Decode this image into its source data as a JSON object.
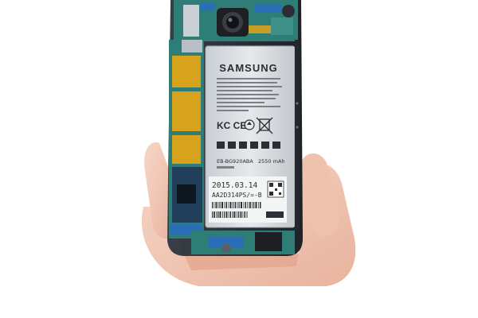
{
  "image": {
    "subject": "Smartphone with back cover removed held in a hand, showing battery and logic board",
    "colors": {
      "background": "#ffffff",
      "skin": "#f1c9b5",
      "skin_shadow": "#e3ab95",
      "board_green": "#2f7d77",
      "board_blue": "#2a6fb5",
      "shield_gold": "#d8a31c",
      "frame_dark": "#2c2f36",
      "battery_silver": "#d9dde1",
      "label_white": "#f4f5f5"
    }
  },
  "battery": {
    "brand": "SAMSUNG",
    "model": "EB-BG920ABA",
    "capacity": "2550 mAh",
    "date": "2015.03.14",
    "serial": "AA2D314PS/=-B"
  },
  "icons": {
    "ce_mark": "ce-mark-icon",
    "recycle": "recycle-icon",
    "crossed_bin": "crossed-bin-icon",
    "qr_code": "qr-code-icon",
    "camera": "camera-lens-icon"
  }
}
